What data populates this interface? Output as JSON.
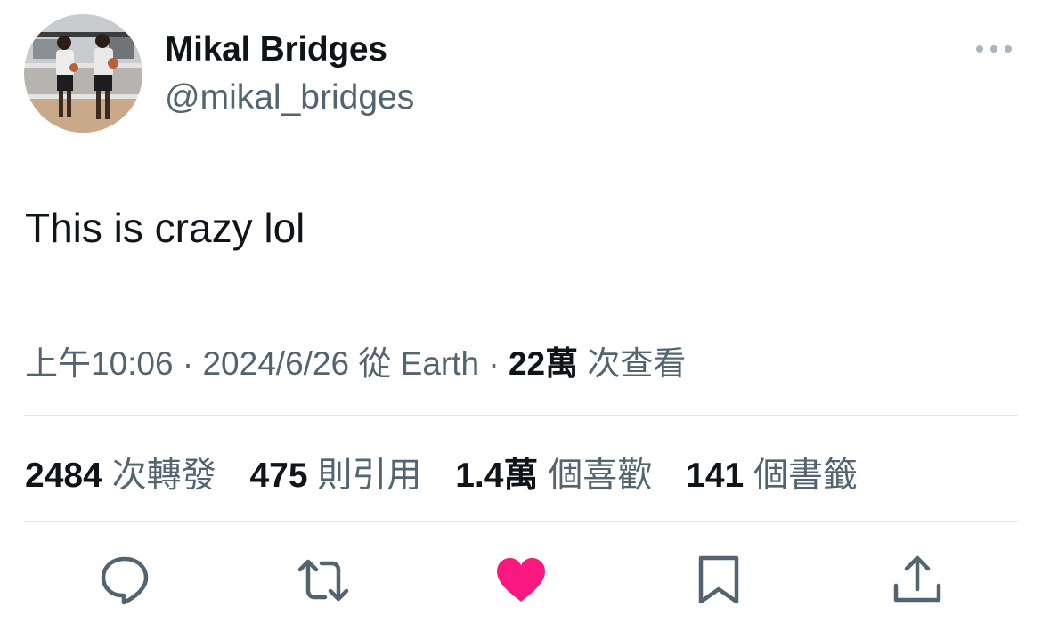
{
  "author": {
    "name": "Mikal Bridges",
    "handle": "@mikal_bridges"
  },
  "tweet": {
    "text": "This is crazy lol"
  },
  "meta": {
    "time": "上午10:06",
    "sep1": " · ",
    "date": "2024/6/26",
    "source": " 從 Earth",
    "sep2": " · ",
    "views_count": "22萬",
    "views_label": " 次查看"
  },
  "stats": {
    "retweets": {
      "count": "2484",
      "label": " 次轉發"
    },
    "quotes": {
      "count": "475",
      "label": " 則引用"
    },
    "likes": {
      "count": "1.4萬",
      "label": " 個喜歡"
    },
    "bookmarks": {
      "count": "141",
      "label": " 個書籤"
    }
  },
  "actions": [
    "reply-icon",
    "retweet-icon",
    "like-icon",
    "bookmark-icon",
    "share-icon"
  ],
  "colors": {
    "text": "#0f1419",
    "secondary": "#536471",
    "like": "#f91880",
    "divider": "#e6e9ec"
  }
}
